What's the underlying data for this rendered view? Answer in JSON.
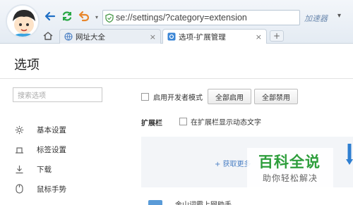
{
  "browser": {
    "url": "se://settings/?category=extension",
    "accelerator_label": "加速器",
    "tabs": [
      {
        "label": "网址大全",
        "active": false
      },
      {
        "label": "选项-扩展管理",
        "active": true
      }
    ],
    "new_tab_label": "+",
    "tab_close_glyph": "×"
  },
  "page": {
    "title": "选项",
    "search_placeholder": "搜索选项",
    "sidebar": [
      {
        "icon": "gear-icon",
        "label": "基本设置"
      },
      {
        "icon": "tab-icon",
        "label": "标签设置"
      },
      {
        "icon": "download-icon",
        "label": "下载"
      },
      {
        "icon": "mouse-icon",
        "label": "鼠标手势"
      }
    ],
    "main": {
      "dev_mode_label": "启用开发者模式",
      "enable_all_label": "全部启用",
      "disable_all_label": "全部禁用",
      "extension_bar_label": "扩展栏",
      "show_dynamic_text_label": "在扩展栏显示动态文字",
      "get_more_label": "+ 获取更多",
      "extension_item_name": "金山词霸上网助手"
    }
  },
  "watermark": {
    "big": "百科全说",
    "small": "助你轻松解决"
  },
  "colors": {
    "nav_blue": "#1f6fc5",
    "refresh_green": "#28a745",
    "undo_orange": "#e8862b",
    "link_blue": "#4a7fc4",
    "watermark_green": "#2e9e3c"
  }
}
